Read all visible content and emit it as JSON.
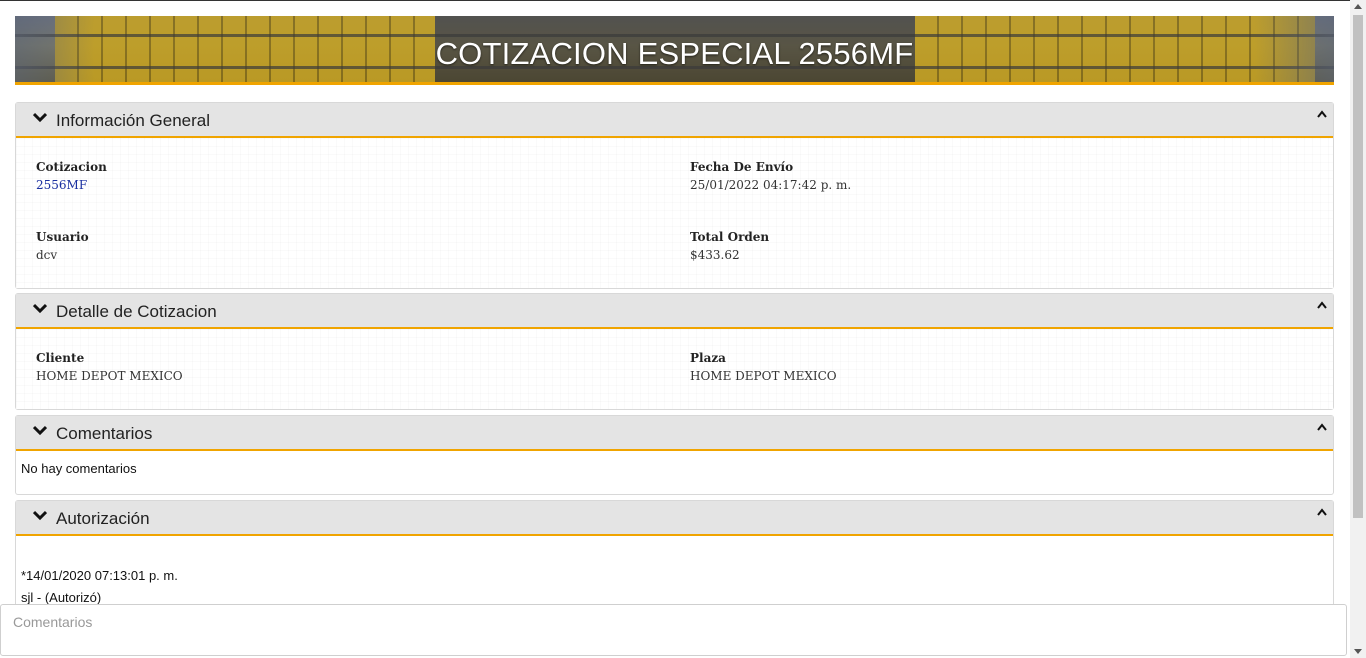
{
  "banner": {
    "title": "COTIZACION ESPECIAL 2556MF"
  },
  "sections": {
    "general": {
      "title": "Información General",
      "fields": {
        "cotizacion": {
          "label": "Cotizacion",
          "value": "2556MF"
        },
        "fecha": {
          "label": "Fecha De Envío",
          "value": "25/01/2022 04:17:42 p. m."
        },
        "usuario": {
          "label": "Usuario",
          "value": "dcv"
        },
        "total": {
          "label": "Total Orden",
          "value": "$433.62"
        }
      }
    },
    "detalle": {
      "title": "Detalle de Cotizacion",
      "fields": {
        "cliente": {
          "label": "Cliente",
          "value": "HOME DEPOT MEXICO"
        },
        "plaza": {
          "label": "Plaza",
          "value": "HOME DEPOT MEXICO"
        }
      }
    },
    "comentarios": {
      "title": "Comentarios",
      "empty_text": "No hay comentarios"
    },
    "autorizacion": {
      "title": "Autorización",
      "entries": [
        {
          "timestamp": "*14/01/2020 07:13:01 p. m.",
          "detail": "sjl - (Autorizó)"
        }
      ]
    }
  },
  "comment_box": {
    "placeholder": "Comentarios"
  },
  "icons": {
    "expand": "chevron-down-icon",
    "collapse": "caret-up-icon"
  },
  "colors": {
    "accent": "#f0a400",
    "header_bg": "#e4e4e4",
    "link": "#1a2fa0"
  }
}
